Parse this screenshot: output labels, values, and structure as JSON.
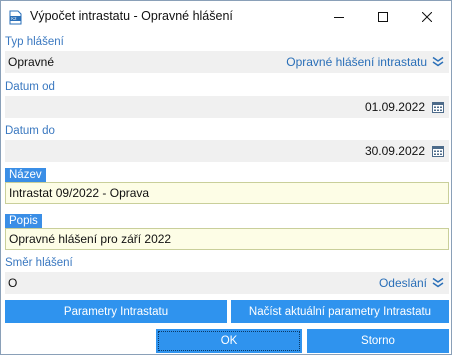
{
  "window": {
    "title": "Výpočet intrastatu - Opravné hlášení",
    "icons": {
      "app": "k2-app-icon",
      "minimize": "minimize-icon",
      "maximize": "maximize-icon",
      "close": "close-icon"
    }
  },
  "form": {
    "typ": {
      "label": "Typ hlášení",
      "value": "Opravné",
      "link": "Opravné hlášení intrastatu",
      "icon": "chevron-double-down-icon"
    },
    "datum_od": {
      "label": "Datum od",
      "value": "01.09.2022",
      "icon": "calendar-icon"
    },
    "datum_do": {
      "label": "Datum do",
      "value": "30.09.2022",
      "icon": "calendar-icon"
    },
    "nazev": {
      "label": "Název",
      "value": "Intrastat 09/2022 - Oprava"
    },
    "popis": {
      "label": "Popis",
      "value": "Opravné hlášení pro září 2022"
    },
    "smer": {
      "label": "Směr hlášení",
      "value": "O",
      "link": "Odeslání",
      "icon": "chevron-double-down-icon"
    }
  },
  "buttons": {
    "parametry": "Parametry Intrastatu",
    "nacist": "Načíst aktuální parametry Intrastatu",
    "ok": "OK",
    "storno": "Storno"
  },
  "colors": {
    "accent": "#2f93ee",
    "label": "#3a78c0",
    "required_field": "#fdfde6",
    "field": "#f0f0f0"
  }
}
